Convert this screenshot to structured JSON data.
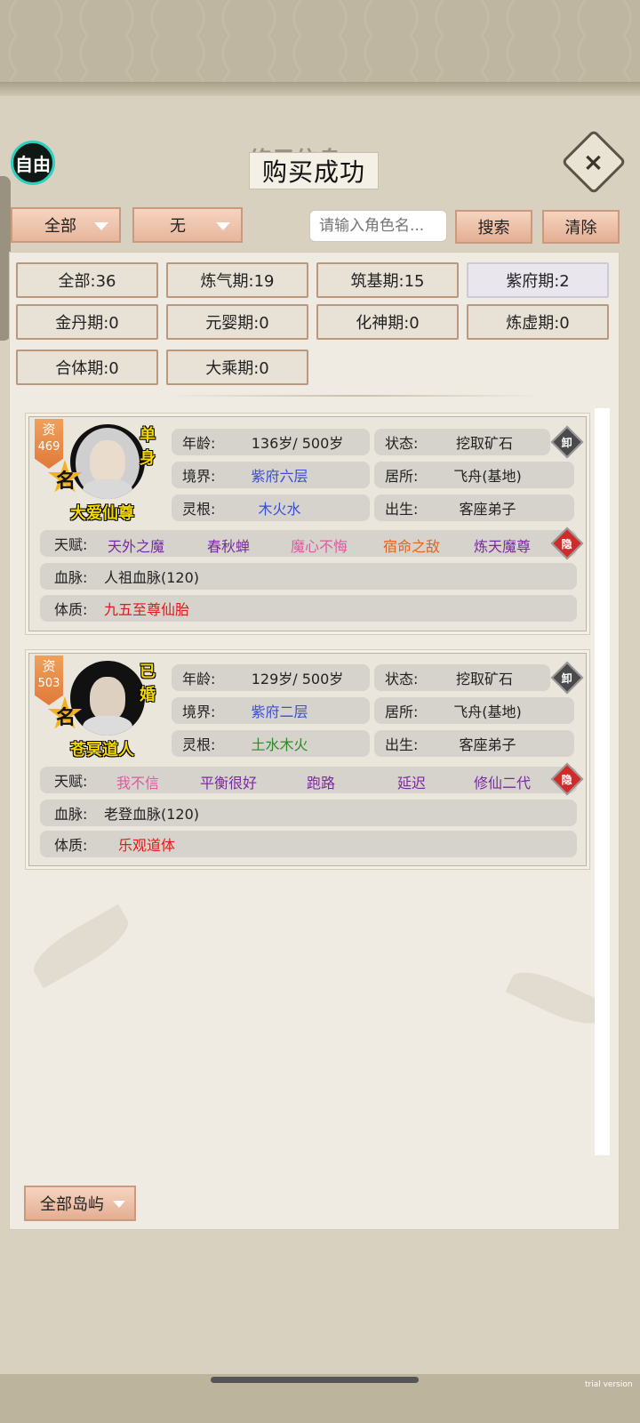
{
  "header": {
    "free_label": "自由",
    "title_ghost": "修子信息",
    "toast": "购买成功",
    "close_glyph": "×"
  },
  "filters": {
    "dropdown_all": "全部",
    "dropdown_none": "无",
    "search_placeholder": "请输入角色名...",
    "search_label": "搜索",
    "clear_label": "清除"
  },
  "stages": [
    {
      "label": "全部:36"
    },
    {
      "label": "炼气期:19"
    },
    {
      "label": "筑基期:15"
    },
    {
      "label": "紫府期:2"
    },
    {
      "label": "金丹期:0"
    },
    {
      "label": "元婴期:0"
    },
    {
      "label": "化神期:0"
    },
    {
      "label": "炼虚期:0"
    },
    {
      "label": "合体期:0"
    },
    {
      "label": "大乘期:0"
    }
  ],
  "labels": {
    "age": "年龄:",
    "realm": "境界:",
    "root": "灵根:",
    "status": "状态:",
    "residence": "居所:",
    "origin": "出生:",
    "talent": "天赋:",
    "bloodline": "血脉:",
    "physique": "体质:",
    "zi": "资",
    "ming": "名",
    "unequip": "卸",
    "hide": "隐"
  },
  "characters": [
    {
      "zi_value": "469",
      "marital": "单身",
      "name": "大爱仙尊",
      "age": "136岁/ 500岁",
      "realm": "紫府六层",
      "root": "木火水",
      "status": "挖取矿石",
      "residence": "飞舟(基地)",
      "origin": "客座弟子",
      "talents": [
        "天外之魔",
        "春秋蝉",
        "魔心不悔",
        "宿命之敌",
        "炼天魔尊"
      ],
      "talent_colors": [
        "#7a2aa0",
        "#7a2aa0",
        "#e05aa0",
        "#e5641a",
        "#7a2aa0"
      ],
      "bloodline": "人祖血脉(120)",
      "physique": "九五至尊仙胎"
    },
    {
      "zi_value": "503",
      "marital": "已婚",
      "name": "苍冥道人",
      "age": "129岁/ 500岁",
      "realm": "紫府二层",
      "root": "土水木火",
      "status": "挖取矿石",
      "residence": "飞舟(基地)",
      "origin": "客座弟子",
      "talents": [
        "我不信",
        "平衡很好",
        "跑路",
        "延迟",
        "修仙二代"
      ],
      "talent_colors": [
        "#e05aa0",
        "#7a2aa0",
        "#7a2aa0",
        "#7a2aa0",
        "#7a2aa0"
      ],
      "bloodline": "老登血脉(120)",
      "physique": "乐观道体"
    }
  ],
  "bottom": {
    "island_dropdown": "全部岛屿"
  },
  "watermark": "trial version"
}
